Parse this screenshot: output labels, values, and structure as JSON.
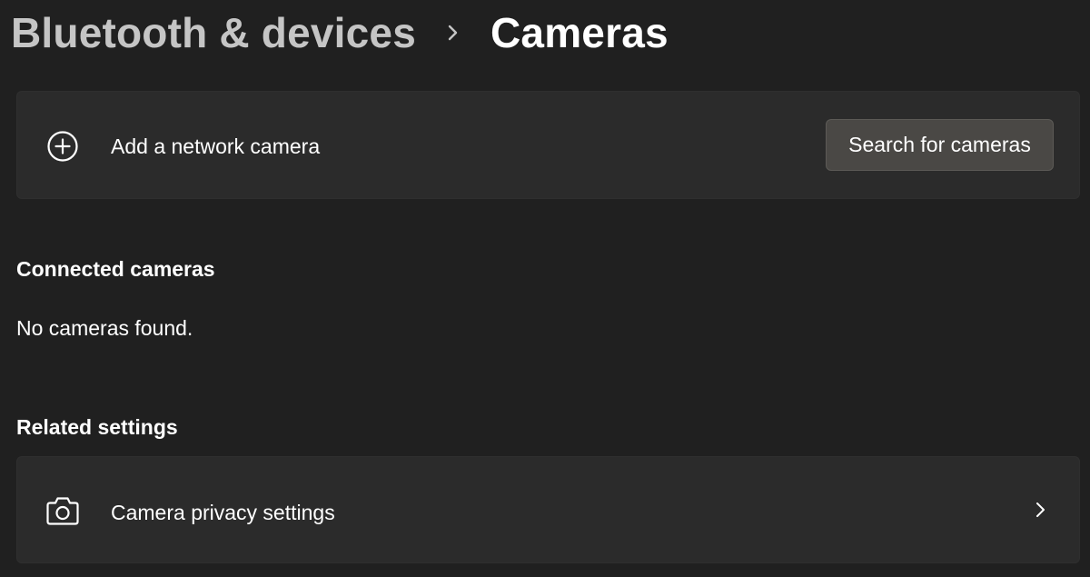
{
  "breadcrumb": {
    "parent": "Bluetooth & devices",
    "separator_icon": "chevron-right-icon",
    "current": "Cameras"
  },
  "add_camera": {
    "icon": "add-circle-icon",
    "label": "Add a network camera",
    "button_label": "Search for cameras"
  },
  "connected": {
    "heading": "Connected cameras",
    "empty_message": "No cameras found."
  },
  "related": {
    "heading": "Related settings",
    "items": [
      {
        "icon": "camera-icon",
        "label": "Camera privacy settings",
        "trailing_icon": "chevron-right-icon"
      }
    ]
  },
  "colors": {
    "background": "#202020",
    "card": "#2b2b2b",
    "button": "#4a4845",
    "breadcrumb_parent": "#c5c5c5",
    "text": "#ffffff"
  }
}
